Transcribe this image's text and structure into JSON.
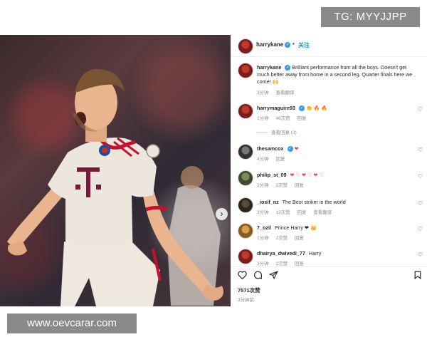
{
  "watermarks": {
    "top": "TG: MYYJJPP",
    "bottom": "www.oevcarar.com"
  },
  "post": {
    "header": {
      "username": "harrykane",
      "follow_label": "关注",
      "separator": "•"
    },
    "caption": {
      "username": "harrykane",
      "text": "Brilliant performance from all the boys. Doesn't get much better away from home in a second leg. Quarter finals here we come! 🙌",
      "time": "3分钟",
      "translate": "查看翻译"
    },
    "comments": [
      {
        "username": "harrymaguire93",
        "text": "👏 🔥 🔥",
        "time": "1分钟",
        "likes": "46次赞",
        "reply": "回复",
        "view_replies": "查看回复 (3)"
      },
      {
        "username": "thesamcox",
        "text": "❤",
        "time": "4分钟",
        "reply": "回复"
      },
      {
        "username": "philip_st_09",
        "text": "❤ ♡ ❤ ♡ ❤ ♡",
        "time": "2分钟",
        "likes": "2次赞",
        "reply": "回复"
      },
      {
        "username": "_iosif_nz",
        "text": "The Best striker in the world",
        "time": "3分钟",
        "likes": "13次赞",
        "reply": "回复",
        "translate": "查看翻译"
      },
      {
        "username": "7_ozil",
        "text": "Prince Harry ❤ 👑",
        "time": "1分钟",
        "likes": "2次赞",
        "reply": "回复"
      },
      {
        "username": "dhairya_dwivedi_77",
        "text": "Harry",
        "time": "3分钟",
        "likes": "2次赞",
        "reply": "回复"
      }
    ],
    "likes_count": "7571次赞",
    "posted_time": "3分钟前",
    "icons": [
      "heart-icon",
      "comment-icon",
      "share-icon",
      "bookmark-icon"
    ],
    "colors": {
      "link_blue": "#0095f6",
      "verified_blue": "#3897f0",
      "heart_red": "#ed4956",
      "jersey_red": "#c8102e"
    }
  }
}
